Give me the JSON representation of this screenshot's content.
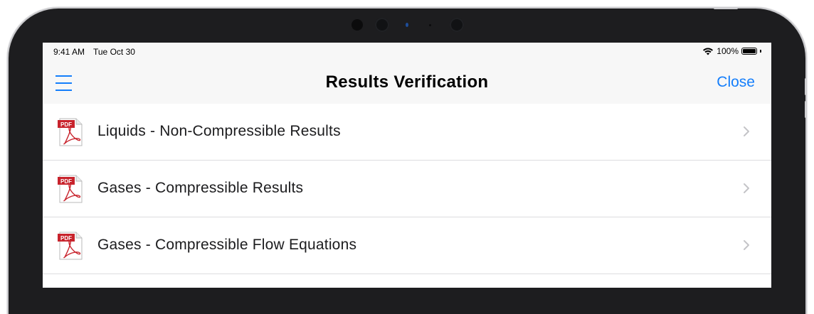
{
  "status_bar": {
    "time": "9:41 AM",
    "date": "Tue Oct 30",
    "battery": "100%",
    "wifi_icon": "wifi-icon",
    "battery_icon": "battery-icon"
  },
  "nav": {
    "title": "Results Verification",
    "close_label": "Close",
    "menu_icon": "hamburger-menu-icon"
  },
  "list": {
    "items": [
      {
        "label": "Liquids - Non-Compressible Results",
        "icon": "pdf-icon",
        "accessory": "chevron-right-icon"
      },
      {
        "label": "Gases - Compressible Results",
        "icon": "pdf-icon",
        "accessory": "chevron-right-icon"
      },
      {
        "label": "Gases - Compressible Flow Equations",
        "icon": "pdf-icon",
        "accessory": "chevron-right-icon"
      }
    ]
  },
  "colors": {
    "accent": "#147efb",
    "pdf_red": "#c8232c",
    "bar_background": "#f7f7f7",
    "separator": "#dcdcdf"
  }
}
